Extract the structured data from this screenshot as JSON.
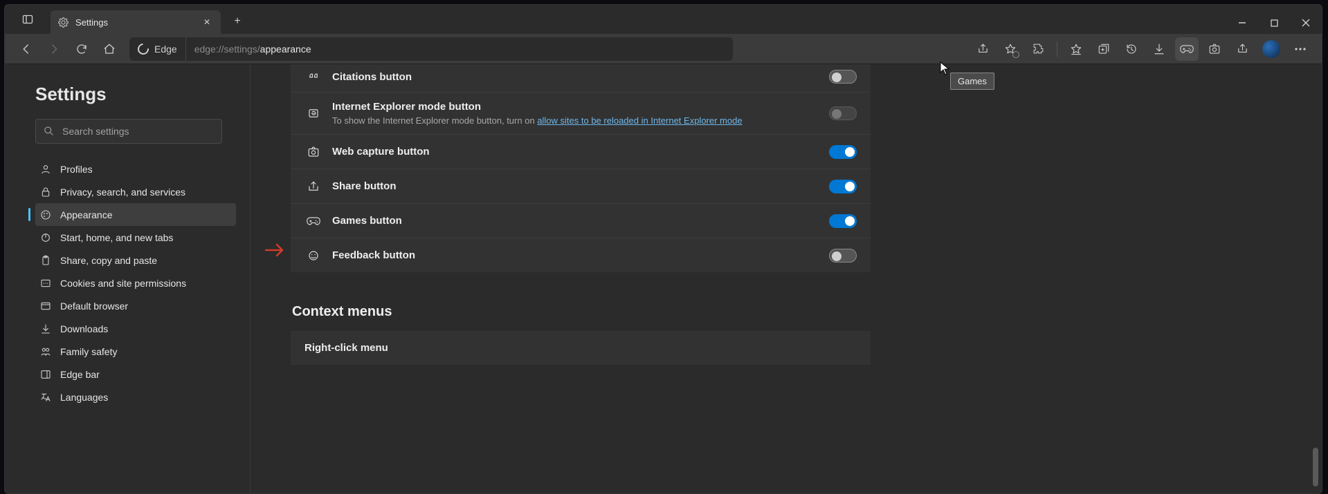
{
  "window": {
    "minimize": "—",
    "maximize": "▢",
    "close": "✕"
  },
  "tab": {
    "title": "Settings",
    "close_glyph": "✕",
    "new_tab": "+"
  },
  "toolbar": {
    "edge_label": "Edge",
    "url_protocol": "edge://",
    "url_mid": "settings/",
    "url_page": "appearance"
  },
  "tooltip": {
    "games": "Games"
  },
  "settings": {
    "heading": "Settings",
    "search_placeholder": "Search settings",
    "nav": [
      "Profiles",
      "Privacy, search, and services",
      "Appearance",
      "Start, home, and new tabs",
      "Share, copy and paste",
      "Cookies and site permissions",
      "Default browser",
      "Downloads",
      "Family safety",
      "Edge bar",
      "Languages"
    ],
    "active_nav_index": 2
  },
  "rows": {
    "citations": "Citations button",
    "ie_mode": "Internet Explorer mode button",
    "ie_sub_pre": "To show the Internet Explorer mode button, turn on ",
    "ie_sub_link": "allow sites to be reloaded in Internet Explorer mode",
    "web_capture": "Web capture button",
    "share": "Share button",
    "games": "Games button",
    "feedback": "Feedback button"
  },
  "context_menus": {
    "heading": "Context menus",
    "right_click": "Right-click menu"
  }
}
